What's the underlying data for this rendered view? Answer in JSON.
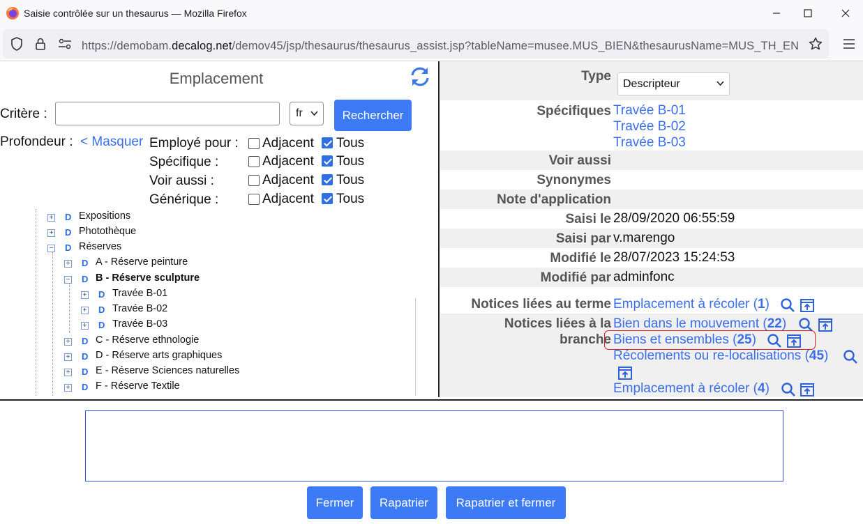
{
  "window": {
    "title": "Saisie contrôlée sur un thesaurus — Mozilla Firefox",
    "url_prefix": "https://demobam.",
    "url_domain": "decalog.net",
    "url_path": "/demov45/jsp/thesaurus/thesaurus_assist.jsp?tableName=musee.MUS_BIEN&thesaurusName=MUS_TH_EN"
  },
  "left": {
    "title": "Emplacement",
    "criteria_label": "Critère :",
    "criteria_value": "",
    "lang_value": "fr",
    "search_button": "Rechercher",
    "depth_label": "Profondeur :",
    "hide_link": "< Masquer",
    "filters": [
      {
        "label": "Employé pour :",
        "adjacent_label": "Adjacent",
        "adjacent_checked": false,
        "all_label": "Tous",
        "all_checked": true
      },
      {
        "label": "Spécifique :",
        "adjacent_label": "Adjacent",
        "adjacent_checked": false,
        "all_label": "Tous",
        "all_checked": true
      },
      {
        "label": "Voir aussi :",
        "adjacent_label": "Adjacent",
        "adjacent_checked": false,
        "all_label": "Tous",
        "all_checked": true
      },
      {
        "label": "Générique :",
        "adjacent_label": "Adjacent",
        "adjacent_checked": false,
        "all_label": "Tous",
        "all_checked": true
      }
    ],
    "tree": [
      {
        "label": "Expositions",
        "toggle": "+",
        "marker": "D",
        "bold": false
      },
      {
        "label": "Photothèque",
        "toggle": "+",
        "marker": "D",
        "bold": false
      },
      {
        "label": "Réserves",
        "toggle": "−",
        "marker": "D",
        "bold": false
      },
      {
        "label": "A - Réserve peinture",
        "toggle": "+",
        "marker": "D",
        "bold": false
      },
      {
        "label": "B - Réserve sculpture",
        "toggle": "−",
        "marker": "D",
        "bold": true
      },
      {
        "label": "Travée B-01",
        "toggle": "+",
        "marker": "D",
        "bold": false
      },
      {
        "label": "Travée B-02",
        "toggle": "+",
        "marker": "D",
        "bold": false
      },
      {
        "label": "Travée B-03",
        "toggle": "+",
        "marker": "D",
        "bold": false
      },
      {
        "label": "C - Réserve ethnologie",
        "toggle": "+",
        "marker": "D",
        "bold": false
      },
      {
        "label": "D - Réserve arts graphiques",
        "toggle": "+",
        "marker": "D",
        "bold": false
      },
      {
        "label": "E - Réserve Sciences naturelles",
        "toggle": "+",
        "marker": "D",
        "bold": false
      },
      {
        "label": "F - Réserve Textile",
        "toggle": "+",
        "marker": "D",
        "bold": false
      }
    ]
  },
  "right": {
    "type_label": "Type",
    "type_value": "Descripteur",
    "specifics_label": "Spécifiques",
    "specifics": [
      "Travée B-01",
      "Travée B-02",
      "Travée B-03"
    ],
    "see_also_label": "Voir aussi",
    "synonyms_label": "Synonymes",
    "note_label": "Note d'application",
    "entered_on_label": "Saisi le",
    "entered_on_value": "28/09/2020 06:55:59",
    "entered_by_label": "Saisi par",
    "entered_by_value": "v.marengo",
    "modified_on_label": "Modifié le",
    "modified_on_value": "28/07/2023 15:24:53",
    "modified_by_label": "Modifié par",
    "modified_by_value": "adminfonc",
    "term_notices_label": "Notices liées au terme",
    "term_notices": [
      {
        "text": "Emplacement à récoler",
        "count": "1"
      }
    ],
    "branch_notices_label_1": "Notices liées à la",
    "branch_notices_label_2": "branche",
    "branch_notices": [
      {
        "text": "Bien dans le mouvement",
        "count": "22"
      },
      {
        "text": "Biens et ensembles",
        "count": "25"
      },
      {
        "text": "Récolements ou re-localisations",
        "count": "45"
      },
      {
        "text": "Emplacement à récoler",
        "count": "4"
      }
    ]
  },
  "bottom": {
    "textarea_value": "",
    "close_button": "Fermer",
    "bring_back_button": "Rapatrier",
    "bring_back_close_button": "Rapatrier et fermer"
  },
  "colors": {
    "accent": "#3d7af5",
    "link": "#3b6ee8",
    "highlight": "#e02020"
  }
}
